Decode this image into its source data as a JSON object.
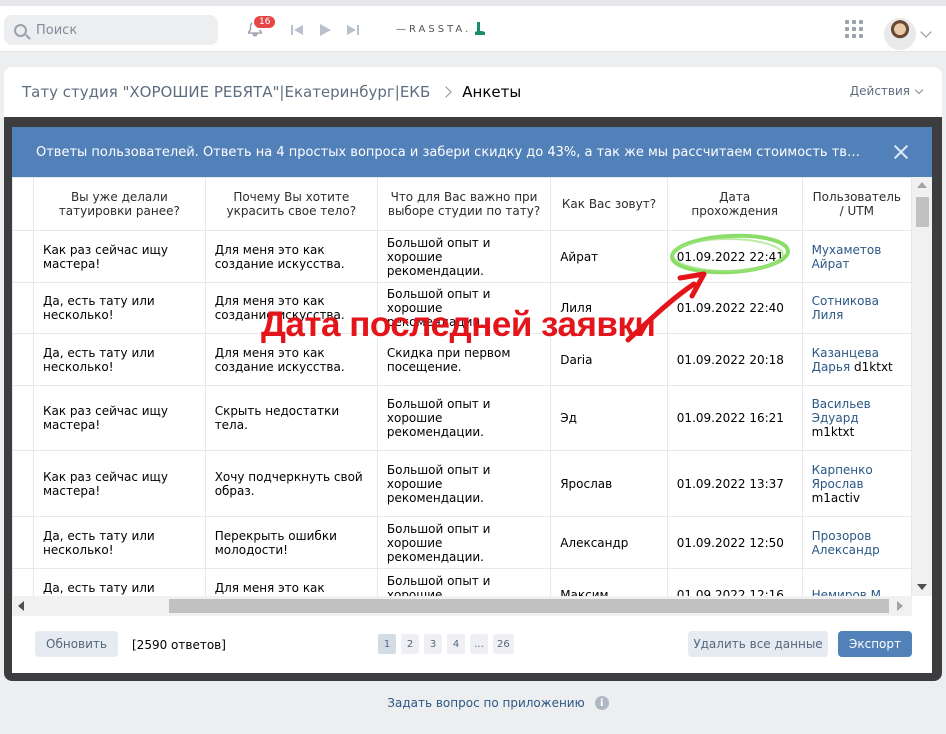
{
  "topbar": {
    "search_placeholder": "Поиск",
    "notifications_count": "16",
    "brand": "—RASSTA."
  },
  "breadcrumb": {
    "community": "Тату студия \"ХОРОШИЕ РЕБЯТА\"|Екатеринбург|ЕКБ",
    "current": "Анкеты"
  },
  "actions_label": "Действия",
  "modal": {
    "title": "Ответы пользователей. Ответь на 4 простых вопроса и забери скидку до 43%, а так же мы рассчитаем стоимость твоей тату с ...",
    "columns": [
      "Вы уже делали татуировки ранее?",
      "Почему Вы хотите украсить свое тело?",
      "Что для Вас важно при выборе студии по тату?",
      "Как Вас зовут?",
      "Дата прохождения",
      "Пользователь / UTM"
    ],
    "rows": [
      {
        "q1": "Как раз сейчас ищу мастера!",
        "q2": "Для меня это как создание искусства.",
        "q3": "Большой опыт и хорошие рекомендации.",
        "name": "Айрат",
        "date": "01.09.2022 22:41",
        "user": "Мухаметов Айрат",
        "utm": ""
      },
      {
        "q1": "Да, есть тату или несколько!",
        "q2": "Для меня это как создание искусства.",
        "q3": "Большой опыт и хорошие рекомендации.",
        "name": "Лиля",
        "date": "01.09.2022 22:40",
        "user": "Сотникова Лиля",
        "utm": ""
      },
      {
        "q1": "Да, есть тату или несколько!",
        "q2": "Для меня это как создание искусства.",
        "q3": "Скидка при первом посещение.",
        "name": "Daria",
        "date": "01.09.2022 20:18",
        "user": "Казанцева Дарья",
        "utm": "d1ktxt"
      },
      {
        "q1": "Как раз сейчас ищу мастера!",
        "q2": "Скрыть недостатки тела.",
        "q3": "Большой опыт и хорошие рекомендации.",
        "name": "Эд",
        "date": "01.09.2022 16:21",
        "user": "Васильев Эдуард",
        "utm": "m1ktxt"
      },
      {
        "q1": "Как раз сейчас ищу мастера!",
        "q2": "Хочу подчеркнуть свой образ.",
        "q3": "Большой опыт и хорошие рекомендации.",
        "name": "Ярослав",
        "date": "01.09.2022 13:37",
        "user": "Карпенко Ярослав",
        "utm": "m1activ"
      },
      {
        "q1": "Да, есть тату или несколько!",
        "q2": "Перекрыть ошибки молодости!",
        "q3": "Большой опыт и хорошие рекомендации.",
        "name": "Александр",
        "date": "01.09.2022 12:50",
        "user": "Прозоров Александр",
        "utm": ""
      },
      {
        "q1": "Да, есть тату или несколько!",
        "q2": "Для меня это как создание искусства.",
        "q3": "Большой опыт и хорошие рекомендации.",
        "name": "Максим",
        "date": "01.09.2022 12:16",
        "user": "Немиров М...",
        "utm": ""
      }
    ]
  },
  "footer": {
    "refresh_label": "Обновить",
    "count_label": "[2590 ответов]",
    "pages": [
      "1",
      "2",
      "3",
      "4",
      "...",
      "26"
    ],
    "active_page": "1",
    "delete_label": "Удалить все данные",
    "export_label": "Экспорт"
  },
  "help_label": "Задать вопрос по приложению",
  "annotation": {
    "text": "Дата последней  заявки",
    "text_color": "#e3141a",
    "circle_color": "#7ed957"
  },
  "colors": {
    "accent": "#5181b8",
    "link": "#2a5885",
    "badge": "#e64646"
  }
}
